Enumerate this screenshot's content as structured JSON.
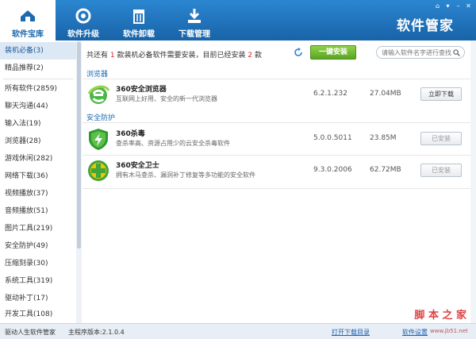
{
  "header": {
    "brand": "软件管家",
    "nav": [
      {
        "label": "软件宝库",
        "icon": "home-icon",
        "active": true
      },
      {
        "label": "软件升级",
        "icon": "refresh-icon",
        "active": false
      },
      {
        "label": "软件卸载",
        "icon": "trash-icon",
        "active": false
      },
      {
        "label": "下载管理",
        "icon": "download-icon",
        "active": false
      }
    ],
    "window_buttons": [
      "⌂",
      "▾",
      "–",
      "✕"
    ]
  },
  "sidebar": {
    "items": [
      {
        "label": "装机必备(3)",
        "active": true
      },
      {
        "label": "精品推荐(2)"
      },
      {
        "label": "所有软件(2859)"
      },
      {
        "label": "聊天沟通(44)"
      },
      {
        "label": "输入法(19)"
      },
      {
        "label": "浏览器(28)"
      },
      {
        "label": "游戏休闲(282)"
      },
      {
        "label": "网络下载(36)"
      },
      {
        "label": "视频播放(37)"
      },
      {
        "label": "音频播放(51)"
      },
      {
        "label": "图片工具(219)"
      },
      {
        "label": "安全防护(49)"
      },
      {
        "label": "压缩刻录(30)"
      },
      {
        "label": "系统工具(319)"
      },
      {
        "label": "驱动补丁(17)"
      },
      {
        "label": "开发工具(108)"
      }
    ]
  },
  "main": {
    "summary_prefix": "共还有",
    "summary_count1": "1",
    "summary_mid": "款装机必备软件需要安装，目前已经安装",
    "summary_count2": "2",
    "summary_suffix": "款",
    "install_all": "一键安装",
    "search_placeholder": "请输入软件名字进行查找",
    "sections": [
      {
        "title": "浏览器",
        "apps": [
          {
            "name": "360安全浏览器",
            "desc": "互联网上好用、安全的新一代浏览器",
            "version": "6.2.1.232",
            "size": "27.04MB",
            "button": "立即下载",
            "installed": false,
            "icon": "browser-e-icon"
          }
        ]
      },
      {
        "title": "安全防护",
        "apps": [
          {
            "name": "360杀毒",
            "desc": "查杀率高、资源占用少的云安全杀毒软件",
            "version": "5.0.0.5011",
            "size": "23.85M",
            "button": "已安装",
            "installed": true,
            "icon": "shield-bolt-icon"
          },
          {
            "name": "360安全卫士",
            "desc": "拥有木马查杀、漏洞补丁修复等多功能的安全软件",
            "version": "9.3.0.2006",
            "size": "62.72MB",
            "button": "已安装",
            "installed": true,
            "icon": "plus-guard-icon"
          }
        ]
      }
    ]
  },
  "status": {
    "left1": "驱动人生软件管家",
    "left2": "主程序版本:2.1.0.4",
    "link1": "打开下载目录",
    "link2": "软件设置"
  },
  "watermark": {
    "text": "脚 本 之 家",
    "sub": "www.jb51.net"
  },
  "colors": {
    "header": "#1a6fb8",
    "accent": "#1b6ab0",
    "install_green": "#5aa524",
    "count_red": "#e02020"
  }
}
